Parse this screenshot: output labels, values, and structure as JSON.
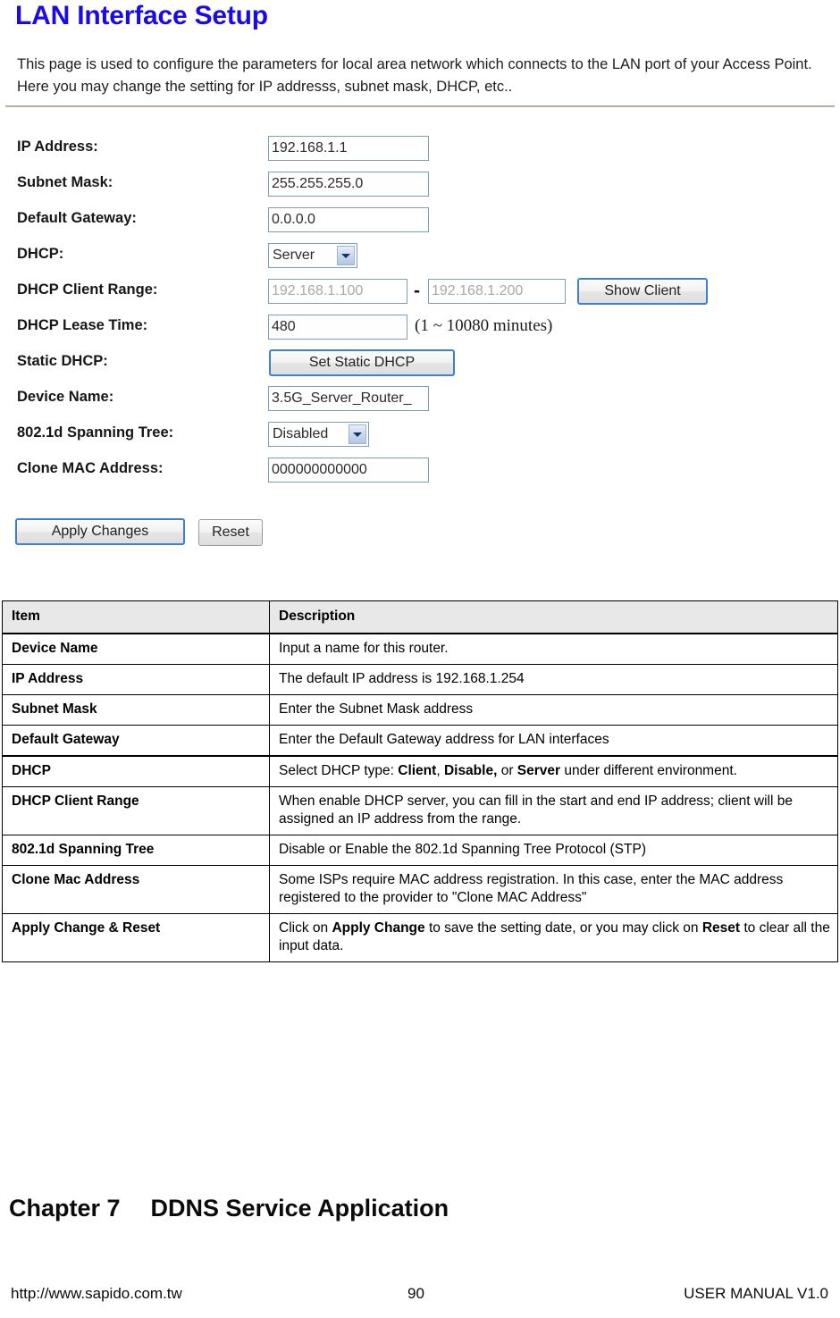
{
  "page": {
    "title": "LAN Interface Setup",
    "title_color": "#1a0ae8",
    "intro": "This page is used to configure the parameters for local area network which connects to the LAN port of your Access Point. Here you may change the setting for IP addresss, subnet mask, DHCP, etc.."
  },
  "form": {
    "ip_address": {
      "label": "IP Address:",
      "value": "192.168.1.1"
    },
    "subnet_mask": {
      "label": "Subnet Mask:",
      "value": "255.255.255.0"
    },
    "default_gateway": {
      "label": "Default Gateway:",
      "value": "0.0.0.0"
    },
    "dhcp": {
      "label": "DHCP:",
      "selected": "Server"
    },
    "dhcp_client_range": {
      "label": "DHCP Client Range:",
      "start": "192.168.1.100",
      "separator": "-",
      "end": "192.168.1.200",
      "show_client_button": "Show Client"
    },
    "dhcp_lease_time": {
      "label": "DHCP Lease Time:",
      "value": "480",
      "hint": "(1 ~ 10080 minutes)"
    },
    "static_dhcp": {
      "label": "Static DHCP:",
      "button": "Set Static DHCP"
    },
    "device_name": {
      "label": "Device Name:",
      "value": "3.5G_Server_Router_"
    },
    "spanning_tree": {
      "label": "802.1d Spanning Tree:",
      "selected": "Disabled"
    },
    "clone_mac": {
      "label": "Clone MAC Address:",
      "value": "000000000000"
    },
    "apply_button": "Apply Changes",
    "reset_button": "Reset"
  },
  "table": {
    "headers": [
      "Item",
      "Description"
    ],
    "rows": [
      {
        "item": "Device Name",
        "desc_html": "Input a name for this router."
      },
      {
        "item": "IP Address",
        "desc_html": "The default IP address is 192.168.1.254"
      },
      {
        "item": "Subnet Mask",
        "desc_html": "Enter the Subnet Mask address"
      },
      {
        "item": "Default Gateway",
        "desc_html": "Enter the Default Gateway address for LAN interfaces"
      },
      {
        "item": "DHCP",
        "desc_html": "Select DHCP type: <b>Client</b>, <b>Disable,</b> or <b>Server</b> under different environment."
      },
      {
        "item": "DHCP Client Range",
        "desc_html": "When enable DHCP server, you can fill in the start and end IP address; client will be assigned an IP address from the range."
      },
      {
        "item": "802.1d Spanning Tree",
        "desc_html": "Disable or Enable the 802.1d Spanning Tree Protocol (STP)"
      },
      {
        "item": "Clone Mac Address",
        "desc_html": "Some ISPs require MAC address registration. In this case, enter the MAC address registered to the provider to \"Clone MAC Address\""
      },
      {
        "item": "Apply Change &amp; Reset",
        "desc_html": "Click on <b>Apply Change</b> to save the setting date, or you may click on <b>Reset</b> to clear all the input data."
      }
    ]
  },
  "chapter": {
    "number": "Chapter 7",
    "name": "DDNS Service Application"
  },
  "footer": {
    "left": "http://www.sapido.com.tw",
    "center": "90",
    "right": "USER MANUAL V1.0"
  }
}
